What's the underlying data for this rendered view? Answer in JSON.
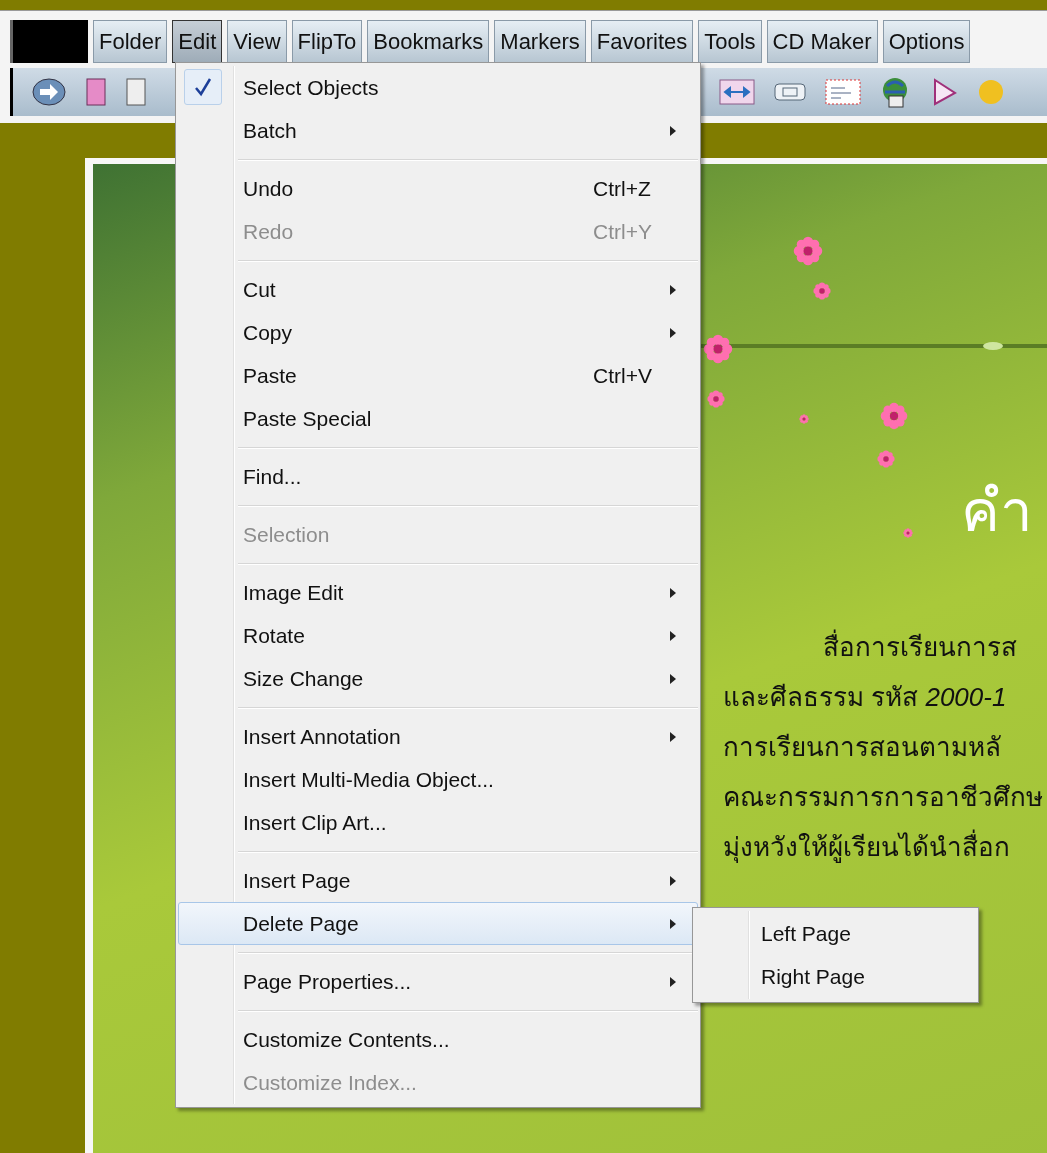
{
  "menubar": [
    {
      "label": "Folder",
      "selected": false
    },
    {
      "label": "Edit",
      "selected": true
    },
    {
      "label": "View",
      "selected": false
    },
    {
      "label": "FlipTo",
      "selected": false
    },
    {
      "label": "Bookmarks",
      "selected": false
    },
    {
      "label": "Markers",
      "selected": false
    },
    {
      "label": "Favorites",
      "selected": false
    },
    {
      "label": "Tools",
      "selected": false
    },
    {
      "label": "CD Maker",
      "selected": false
    },
    {
      "label": "Options",
      "selected": false
    }
  ],
  "page": {
    "heading": "คำ",
    "lines": [
      {
        "kind": "indent",
        "text": "สื่อการเรียนการส"
      },
      {
        "kind": "plain",
        "text": "และศีลธรรม รหัส *2000-1*"
      },
      {
        "kind": "plain",
        "text": "การเรียนการสอนตามหลั"
      },
      {
        "kind": "plain",
        "text": "คณะกรรมการการอาชีวศึกษ"
      },
      {
        "kind": "plain",
        "text": "มุ่งหวังให้ผู้เรียนได้นำสื่อก"
      }
    ]
  },
  "edit_menu": [
    {
      "kind": "item",
      "label": "Select Objects",
      "checked": true,
      "disabled": false,
      "submenu": false,
      "selected": false
    },
    {
      "kind": "item",
      "label": "Batch",
      "checked": false,
      "disabled": false,
      "submenu": true,
      "selected": false
    },
    {
      "kind": "separator"
    },
    {
      "kind": "item",
      "label": "Undo",
      "shortcut": "Ctrl+Z",
      "checked": false,
      "disabled": false,
      "submenu": false,
      "selected": false
    },
    {
      "kind": "item",
      "label": "Redo",
      "shortcut": "Ctrl+Y",
      "checked": false,
      "disabled": true,
      "submenu": false,
      "selected": false
    },
    {
      "kind": "separator"
    },
    {
      "kind": "item",
      "label": "Cut",
      "checked": false,
      "disabled": false,
      "submenu": true,
      "selected": false
    },
    {
      "kind": "item",
      "label": "Copy",
      "checked": false,
      "disabled": false,
      "submenu": true,
      "selected": false
    },
    {
      "kind": "item",
      "label": "Paste",
      "shortcut": "Ctrl+V",
      "checked": false,
      "disabled": false,
      "submenu": false,
      "selected": false
    },
    {
      "kind": "item",
      "label": "Paste Special",
      "checked": false,
      "disabled": false,
      "submenu": false,
      "selected": false
    },
    {
      "kind": "separator"
    },
    {
      "kind": "item",
      "label": "Find...",
      "checked": false,
      "disabled": false,
      "submenu": false,
      "selected": false
    },
    {
      "kind": "separator"
    },
    {
      "kind": "item",
      "label": "Selection",
      "checked": false,
      "disabled": true,
      "submenu": false,
      "selected": false
    },
    {
      "kind": "separator"
    },
    {
      "kind": "item",
      "label": "Image Edit",
      "checked": false,
      "disabled": false,
      "submenu": true,
      "selected": false
    },
    {
      "kind": "item",
      "label": "Rotate",
      "checked": false,
      "disabled": false,
      "submenu": true,
      "selected": false
    },
    {
      "kind": "item",
      "label": "Size Change",
      "checked": false,
      "disabled": false,
      "submenu": true,
      "selected": false
    },
    {
      "kind": "separator"
    },
    {
      "kind": "item",
      "label": "Insert Annotation",
      "checked": false,
      "disabled": false,
      "submenu": true,
      "selected": false
    },
    {
      "kind": "item",
      "label": "Insert Multi-Media Object...",
      "checked": false,
      "disabled": false,
      "submenu": false,
      "selected": false
    },
    {
      "kind": "item",
      "label": "Insert Clip Art...",
      "checked": false,
      "disabled": false,
      "submenu": false,
      "selected": false
    },
    {
      "kind": "separator"
    },
    {
      "kind": "item",
      "label": "Insert Page",
      "checked": false,
      "disabled": false,
      "submenu": true,
      "selected": false
    },
    {
      "kind": "item",
      "label": "Delete Page",
      "checked": false,
      "disabled": false,
      "submenu": true,
      "selected": true
    },
    {
      "kind": "separator"
    },
    {
      "kind": "item",
      "label": "Page Properties...",
      "checked": false,
      "disabled": false,
      "submenu": true,
      "selected": false
    },
    {
      "kind": "separator"
    },
    {
      "kind": "item",
      "label": "Customize Contents...",
      "checked": false,
      "disabled": false,
      "submenu": false,
      "selected": false
    },
    {
      "kind": "item",
      "label": "Customize Index...",
      "checked": false,
      "disabled": true,
      "submenu": false,
      "selected": false
    }
  ],
  "submenu": [
    {
      "label": "Left Page"
    },
    {
      "label": "Right Page"
    }
  ]
}
